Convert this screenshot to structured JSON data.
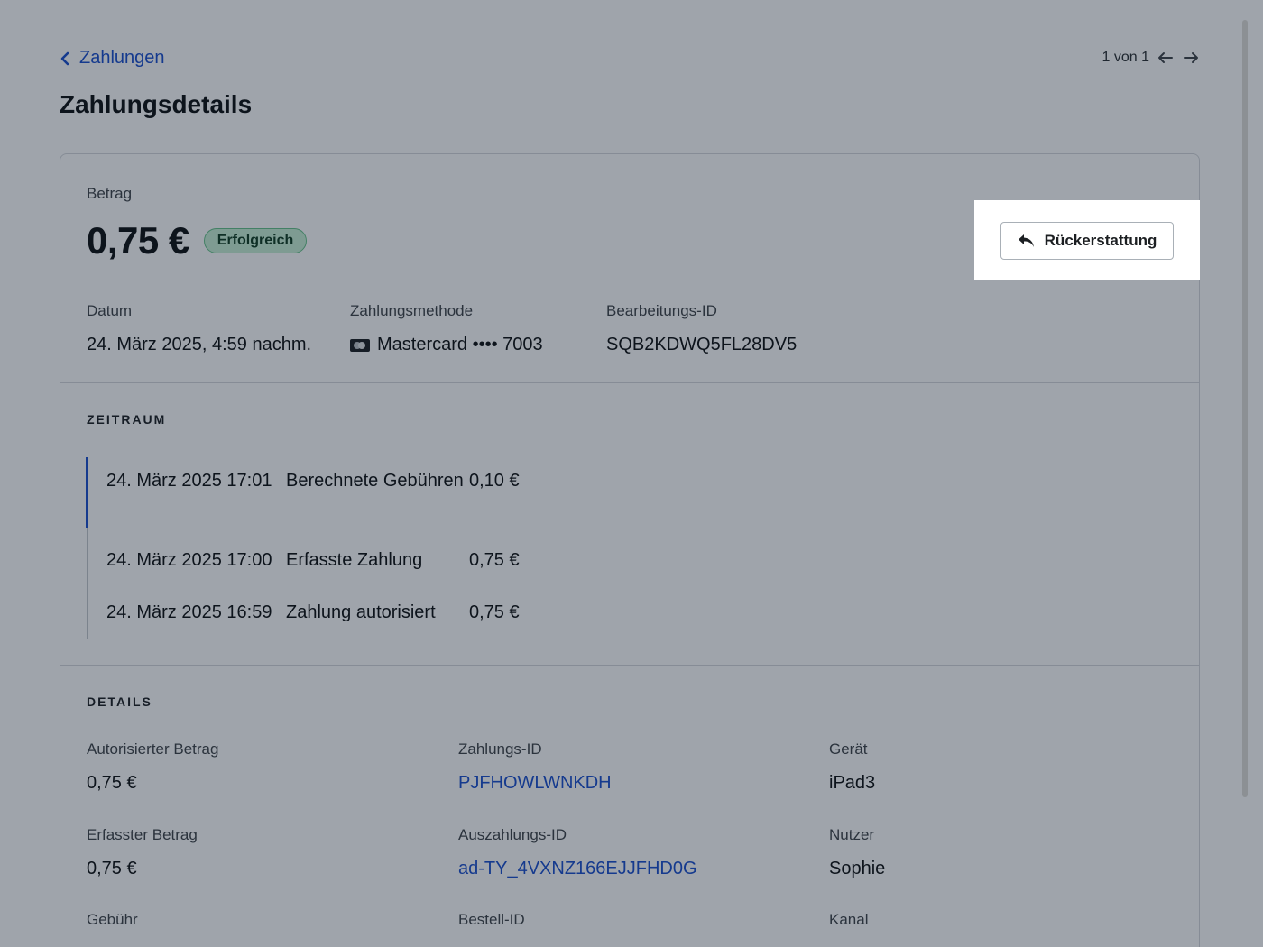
{
  "nav": {
    "back_label": "Zahlungen",
    "pager_text": "1 von 1"
  },
  "page_title": "Zahlungsdetails",
  "summary": {
    "amount_label": "Betrag",
    "amount": "0,75 €",
    "status": "Erfolgreich",
    "refund_label": "Rückerstattung",
    "meta": [
      {
        "label": "Datum",
        "value": "24. März 2025, 4:59 nachm."
      },
      {
        "label": "Zahlungsmethode",
        "value": "Mastercard •••• 7003"
      },
      {
        "label": "Bearbeitungs-ID",
        "value": "SQB2KDWQ5FL28DV5"
      }
    ]
  },
  "timeline": {
    "heading": "ZEITRAUM",
    "events": [
      {
        "date": "24. März 2025 17:01",
        "event": "Berechnete Gebühren",
        "amount": "0,10 €"
      },
      {
        "date": "24. März 2025 17:00",
        "event": "Erfasste Zahlung",
        "amount": "0,75 €"
      },
      {
        "date": "24. März 2025 16:59",
        "event": "Zahlung autorisiert",
        "amount": "0,75 €"
      }
    ]
  },
  "details": {
    "heading": "DETAILS",
    "items": [
      {
        "label": "Autorisierter Betrag",
        "value": "0,75 €"
      },
      {
        "label": "Zahlungs-ID",
        "value": "PJFHOWLWNKDH"
      },
      {
        "label": "Gerät",
        "value": "iPad3"
      },
      {
        "label": "Erfasster Betrag",
        "value": "0,75 €"
      },
      {
        "label": "Auszahlungs-ID",
        "value": "ad-TY_4VXNZ166EJJFHD0G"
      },
      {
        "label": "Nutzer",
        "value": "Sophie"
      },
      {
        "label": "Gebühr",
        "value": ""
      },
      {
        "label": "Bestell-ID",
        "value": ""
      },
      {
        "label": "Kanal",
        "value": ""
      }
    ]
  },
  "colors": {
    "link": "#1a4fcf",
    "badge_bg": "#c9f0d5",
    "badge_border": "#66c48a"
  }
}
